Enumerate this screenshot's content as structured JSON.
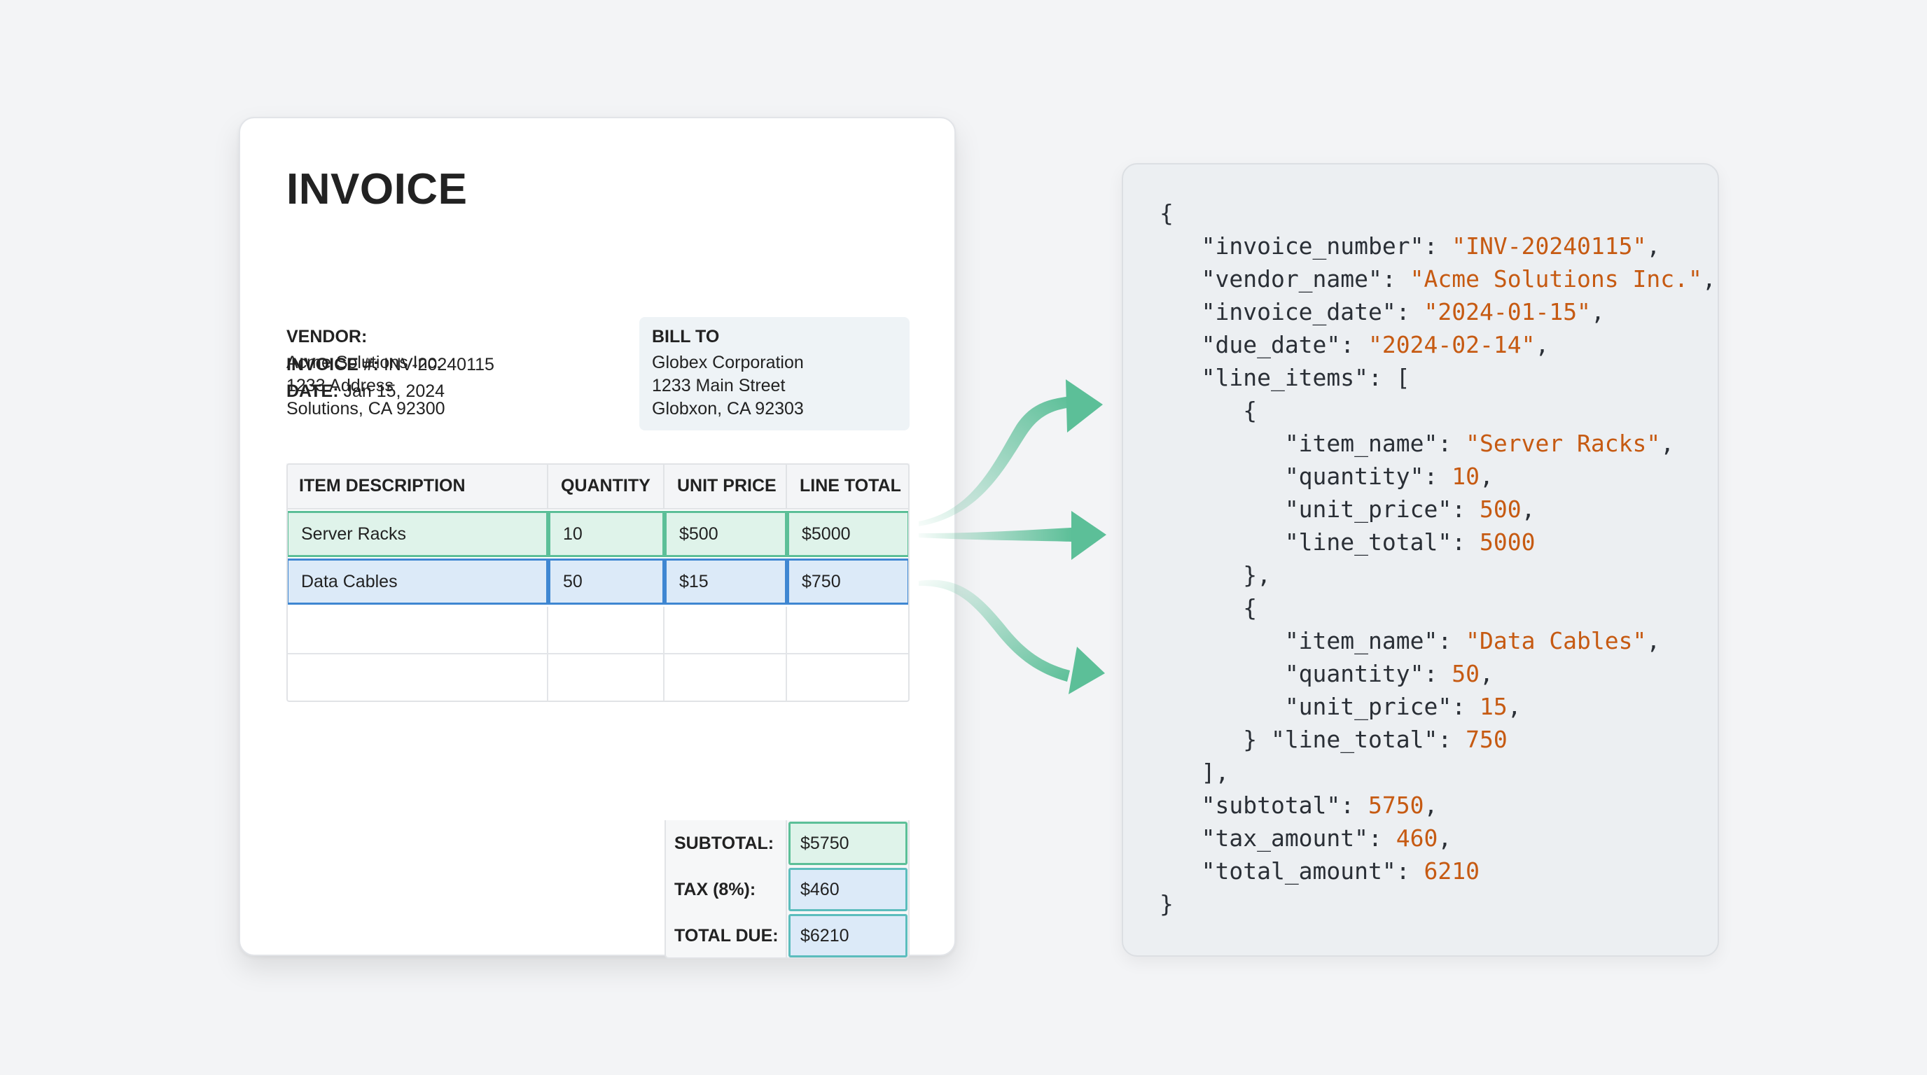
{
  "colors": {
    "highlight_green": "#5cbf98",
    "highlight_blue": "#3f87d2",
    "json_value": "#c65a12",
    "arrow": "#5cbf98"
  },
  "invoice": {
    "title": "INVOICE",
    "number_label": "INVOICE #:",
    "number_value": "INV-20240115",
    "date_label": "DATE:",
    "date_value": "Jan 15, 2024",
    "vendor": {
      "heading": "VENDOR:",
      "lines": [
        "Acme Solutions Inc.",
        "1233 Address",
        "Solutions, CA 92300"
      ]
    },
    "bill_to": {
      "heading": "BILL TO",
      "lines": [
        "Globex Corporation",
        "1233 Main Street",
        "Globxon, CA 92303"
      ]
    },
    "table": {
      "headers": [
        "ITEM DESCRIPTION",
        "QUANTITY",
        "UNIT PRICE",
        "LINE TOTAL"
      ],
      "rows": [
        [
          "Server Racks",
          "10",
          "$500",
          "$5000"
        ],
        [
          "Data Cables",
          "50",
          "$15",
          "$750"
        ]
      ]
    },
    "totals": [
      {
        "label": "SUBTOTAL:",
        "value": "$5750"
      },
      {
        "label": "TAX (8%):",
        "value": "$460"
      },
      {
        "label": "TOTAL DUE:",
        "value": "$6210"
      }
    ]
  },
  "json_output": {
    "open_brace": "{",
    "invoice_number_key": "\"invoice_number\"",
    "invoice_number_val": "\"INV-20240115\"",
    "vendor_name_key": "\"vendor_name\"",
    "vendor_name_val": "\"Acme Solutions Inc.\"",
    "invoice_date_key": "\"invoice_date\"",
    "invoice_date_val": "\"2024-01-15\"",
    "due_date_key": "\"due_date\"",
    "due_date_val": "\"2024-02-14\"",
    "line_items_key": "\"line_items\"",
    "items": [
      {
        "item_name_key": "\"item_name\"",
        "item_name_val": "\"Server Racks\"",
        "quantity_key": "\"quantity\"",
        "quantity_val": "10",
        "unit_price_key": "\"unit_price\"",
        "unit_price_val": "500",
        "line_total_key": "\"line_total\"",
        "line_total_val": "5000"
      },
      {
        "item_name_key": "\"item_name\"",
        "item_name_val": "\"Data Cables\"",
        "quantity_key": "\"quantity\"",
        "quantity_val": "50",
        "unit_price_key": "\"unit_price\"",
        "unit_price_val": "15",
        "line_total_key": "\"line_total\"",
        "line_total_val": "750"
      }
    ],
    "subtotal_key": "\"subtotal\"",
    "subtotal_val": "5750",
    "tax_amount_key": "\"tax_amount\"",
    "tax_amount_val": "460",
    "total_amount_key": "\"total_amount\"",
    "total_amount_val": "6210",
    "close_brace": "}"
  }
}
